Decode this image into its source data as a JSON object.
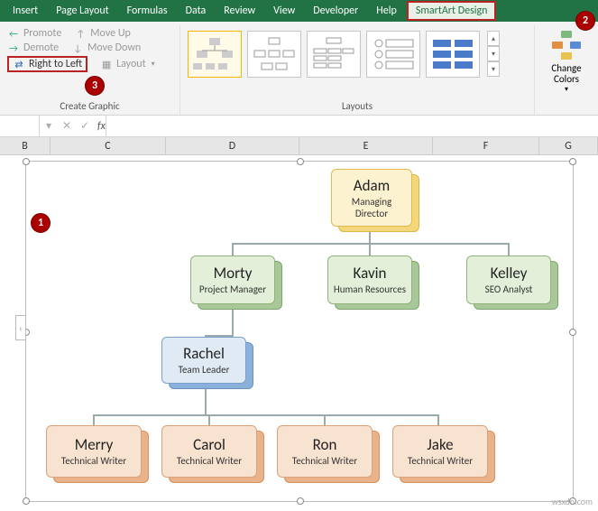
{
  "ribbonTabs": {
    "insert": "Insert",
    "pageLayout": "Page Layout",
    "formulas": "Formulas",
    "data": "Data",
    "review": "Review",
    "view": "View",
    "developer": "Developer",
    "help": "Help",
    "smartArtDesign": "SmartArt Design"
  },
  "createGraphic": {
    "promote": "Promote",
    "demote": "Demote",
    "rightToLeft": "Right to Left",
    "moveUp": "Move Up",
    "moveDown": "Move Down",
    "layout": "Layout",
    "groupLabel": "Create Graphic"
  },
  "layouts": {
    "groupLabel": "Layouts"
  },
  "changeColors": {
    "label": "Change\nColors"
  },
  "callouts": {
    "c1": "1",
    "c2": "2",
    "c3": "3"
  },
  "formulaBar": {
    "fx": "fx"
  },
  "columns": {
    "B": "B",
    "C": "C",
    "D": "D",
    "E": "E",
    "F": "F",
    "G": "G"
  },
  "chart_data": {
    "type": "org-chart",
    "nodes": [
      {
        "id": "adam",
        "name": "Adam",
        "role": "Managing Director",
        "level": 1,
        "color": "gold"
      },
      {
        "id": "morty",
        "name": "Morty",
        "role": "Project Manager",
        "level": 2,
        "parent": "adam",
        "color": "green"
      },
      {
        "id": "kavin",
        "name": "Kavin",
        "role": "Human Resources",
        "level": 2,
        "parent": "adam",
        "color": "green"
      },
      {
        "id": "kelley",
        "name": "Kelley",
        "role": "SEO Analyst",
        "level": 2,
        "parent": "adam",
        "color": "green"
      },
      {
        "id": "rachel",
        "name": "Rachel",
        "role": "Team Leader",
        "level": 3,
        "parent": "morty",
        "color": "blue"
      },
      {
        "id": "merry",
        "name": "Merry",
        "role": "Technical Writer",
        "level": 4,
        "parent": "rachel",
        "color": "orange"
      },
      {
        "id": "carol",
        "name": "Carol",
        "role": "Technical Writer",
        "level": 4,
        "parent": "rachel",
        "color": "orange"
      },
      {
        "id": "ron",
        "name": "Ron",
        "role": "Technical Writer",
        "level": 4,
        "parent": "rachel",
        "color": "orange"
      },
      {
        "id": "jake",
        "name": "Jake",
        "role": "Technical Writer",
        "level": 4,
        "parent": "rachel",
        "color": "orange"
      }
    ]
  },
  "watermark": "wsxdn.com"
}
